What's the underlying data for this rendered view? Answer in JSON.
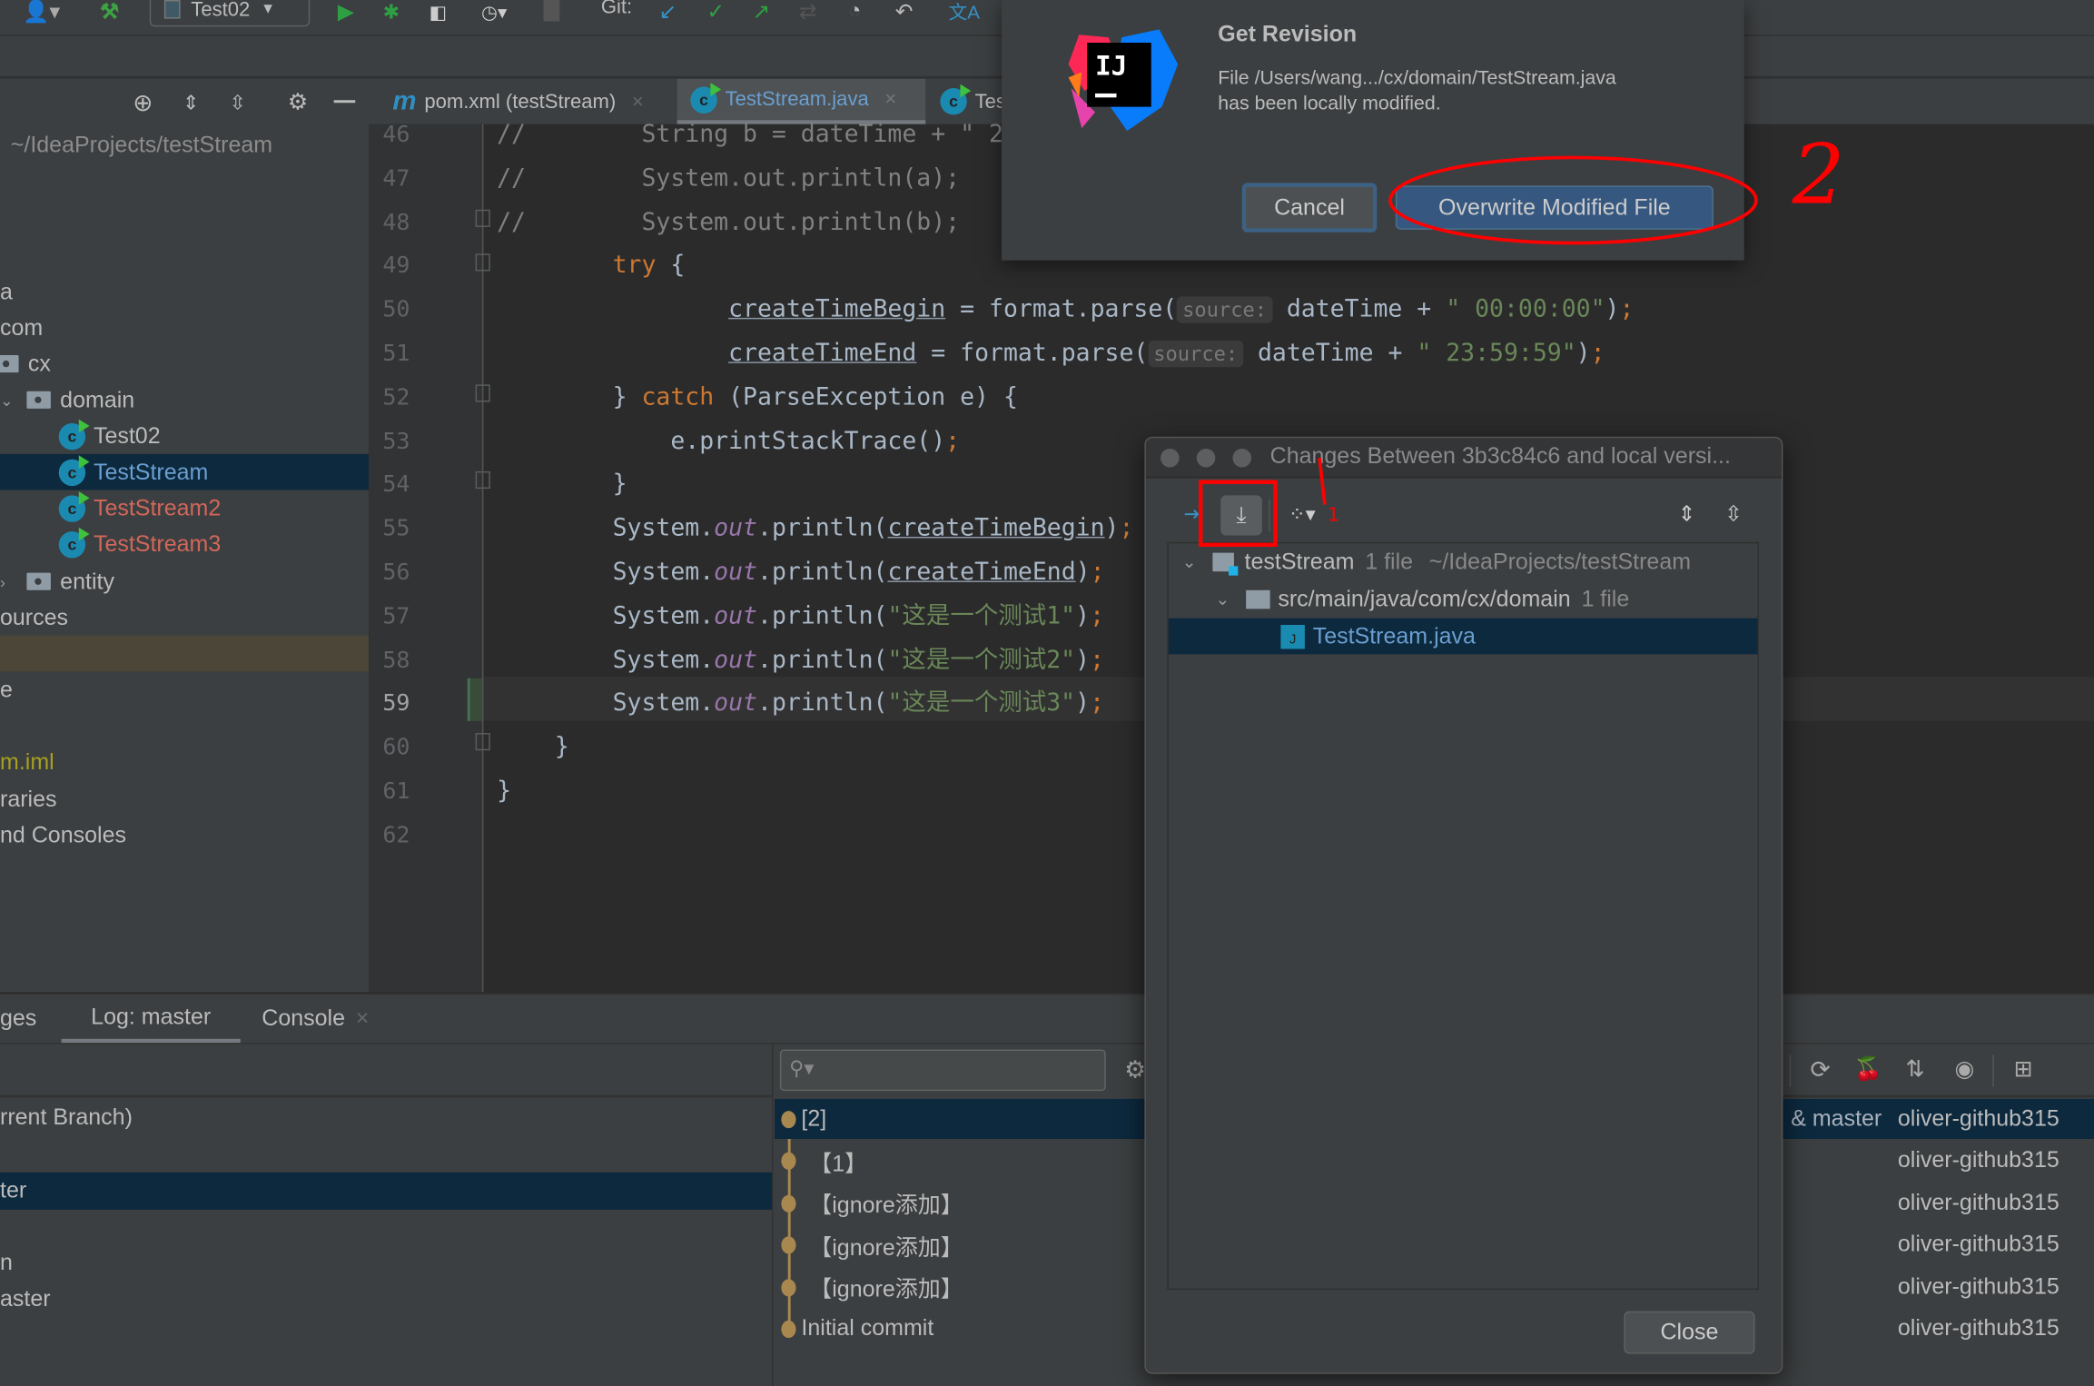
{
  "toolbar": {
    "run_config": "Test02",
    "git_label": "Git:",
    "icons": [
      "user-icon",
      "build-hammer-icon",
      "run-icon",
      "debug-icon",
      "coverage-icon",
      "profile-icon",
      "stop-icon",
      "git-update-icon",
      "git-commit-icon",
      "git-push-icon",
      "git-compare-icon",
      "history-icon",
      "rollback-icon",
      "translate-icon"
    ]
  },
  "project": {
    "path": "~/IdeaProjects/testStream",
    "items": [
      {
        "label": "a"
      },
      {
        "label": "com"
      },
      {
        "label": "cx",
        "icon": "folder-icon"
      },
      {
        "label": "domain",
        "icon": "folder-icon",
        "expanded": true
      },
      {
        "label": "Test02",
        "icon": "class-icon"
      },
      {
        "label": "TestStream",
        "icon": "class-icon",
        "selected": true
      },
      {
        "label": "TestStream2",
        "icon": "class-icon",
        "status": "unversioned"
      },
      {
        "label": "TestStream3",
        "icon": "class-icon",
        "status": "unversioned"
      },
      {
        "label": "entity",
        "icon": "folder-icon",
        "expanded": false
      },
      {
        "label": "ources"
      },
      {
        "label": ""
      },
      {
        "label": "e"
      },
      {
        "label": ""
      },
      {
        "label": "m.iml",
        "status": "ignored"
      },
      {
        "label": "raries"
      },
      {
        "label": "nd Consoles"
      }
    ]
  },
  "editor_tabs": [
    {
      "label": "pom.xml (testStream)",
      "icon": "maven-icon"
    },
    {
      "label": "TestStream.java",
      "icon": "class-icon",
      "active": true
    },
    {
      "label": "Tes",
      "icon": "class-icon"
    }
  ],
  "editor": {
    "current_line": 59,
    "lines": [
      {
        "n": "46",
        "segs": [
          {
            "t": "//        String b = dateTime + \" 2",
            "c": "c"
          }
        ]
      },
      {
        "n": "47",
        "segs": [
          {
            "t": "//        System.out.println(a);",
            "c": "c"
          }
        ]
      },
      {
        "n": "48",
        "segs": [
          {
            "t": "//        System.out.println(b);",
            "c": "c"
          }
        ]
      },
      {
        "n": "49",
        "segs": [
          {
            "t": "        "
          },
          {
            "t": "try",
            "c": "k"
          },
          {
            "t": " {"
          }
        ]
      },
      {
        "n": "50",
        "segs": [
          {
            "t": "                "
          },
          {
            "t": "createTimeBegin",
            "c": "u"
          },
          {
            "t": " = format.parse("
          },
          {
            "t": "source:",
            "c": "h"
          },
          {
            "t": " dateTime + "
          },
          {
            "t": "\" 00:00:00\"",
            "c": "s"
          },
          {
            "t": ")"
          },
          {
            "t": ";",
            "c": "sc"
          }
        ]
      },
      {
        "n": "51",
        "segs": [
          {
            "t": "                "
          },
          {
            "t": "createTimeEnd",
            "c": "u"
          },
          {
            "t": " = format.parse("
          },
          {
            "t": "source:",
            "c": "h"
          },
          {
            "t": " dateTime + "
          },
          {
            "t": "\" 23:59:59\"",
            "c": "s"
          },
          {
            "t": ")"
          },
          {
            "t": ";",
            "c": "sc"
          }
        ]
      },
      {
        "n": "52",
        "segs": [
          {
            "t": "        } "
          },
          {
            "t": "catch",
            "c": "k"
          },
          {
            "t": " (ParseException e) {"
          }
        ]
      },
      {
        "n": "53",
        "segs": [
          {
            "t": "            e.printStackTrace()"
          },
          {
            "t": ";",
            "c": "sc"
          }
        ]
      },
      {
        "n": "54",
        "segs": [
          {
            "t": "        }"
          }
        ]
      },
      {
        "n": "55",
        "segs": [
          {
            "t": "        System."
          },
          {
            "t": "out",
            "c": "f"
          },
          {
            "t": ".println("
          },
          {
            "t": "createTimeBegin",
            "c": "u"
          },
          {
            "t": ")"
          },
          {
            "t": ";",
            "c": "sc"
          }
        ]
      },
      {
        "n": "56",
        "segs": [
          {
            "t": "        System."
          },
          {
            "t": "out",
            "c": "f"
          },
          {
            "t": ".println("
          },
          {
            "t": "createTimeEnd",
            "c": "u"
          },
          {
            "t": ")"
          },
          {
            "t": ";",
            "c": "sc"
          }
        ]
      },
      {
        "n": "57",
        "segs": [
          {
            "t": "        System."
          },
          {
            "t": "out",
            "c": "f"
          },
          {
            "t": ".println("
          },
          {
            "t": "\"这是一个测试1\"",
            "c": "s"
          },
          {
            "t": ")"
          },
          {
            "t": ";",
            "c": "sc"
          }
        ]
      },
      {
        "n": "58",
        "segs": [
          {
            "t": "        System."
          },
          {
            "t": "out",
            "c": "f"
          },
          {
            "t": ".println("
          },
          {
            "t": "\"这是一个测试2\"",
            "c": "s"
          },
          {
            "t": ")"
          },
          {
            "t": ";",
            "c": "sc"
          }
        ]
      },
      {
        "n": "59",
        "segs": [
          {
            "t": "        System."
          },
          {
            "t": "out",
            "c": "f"
          },
          {
            "t": ".println("
          },
          {
            "t": "\"这是一个测试3\"",
            "c": "s"
          },
          {
            "t": ")"
          },
          {
            "t": ";",
            "c": "sc"
          }
        ]
      },
      {
        "n": "60",
        "segs": [
          {
            "t": "    }"
          }
        ]
      },
      {
        "n": "61",
        "segs": [
          {
            "t": "}"
          }
        ]
      },
      {
        "n": "62",
        "segs": []
      }
    ]
  },
  "bottom": {
    "tabs": [
      {
        "label": "ges"
      },
      {
        "label": "Log: master",
        "active": true
      },
      {
        "label": "Console",
        "closable": true
      }
    ],
    "branches": [
      {
        "label": "rrent Branch)"
      },
      {
        "label": "ter",
        "selected": true
      },
      {
        "label": "n"
      },
      {
        "label": "aster"
      }
    ],
    "search_placeholder": "",
    "commits": [
      {
        "message": "[2]",
        "refs": "& master",
        "author": "oliver-github315",
        "selected": true
      },
      {
        "message": "【1】",
        "refs": "",
        "author": "oliver-github315"
      },
      {
        "message": "【ignore添加】",
        "refs": "",
        "author": "oliver-github315"
      },
      {
        "message": "【ignore添加】",
        "refs": "",
        "author": "oliver-github315"
      },
      {
        "message": "【ignore添加】",
        "refs": "",
        "author": "oliver-github315"
      },
      {
        "message": "Initial commit",
        "refs": "",
        "author": "oliver-github315"
      }
    ],
    "graph_color": "#a8884e"
  },
  "get_revision_dialog": {
    "title": "Get Revision",
    "message_line1": "File /Users/wang.../cx/domain/TestStream.java",
    "message_line2": "has been locally modified.",
    "cancel": "Cancel",
    "overwrite": "Overwrite Modified File",
    "logo_text": "IJ"
  },
  "changes_dialog": {
    "title": "Changes Between 3b3c84c6 and local versi...",
    "tree": [
      {
        "label": "testStream",
        "count": "1 file",
        "path": "~/IdeaProjects/testStream"
      },
      {
        "label": "src/main/java/com/cx/domain",
        "count": "1 file"
      },
      {
        "label": "TestStream.java",
        "selected": true
      }
    ],
    "close": "Close"
  },
  "annotations": {
    "step1": "1",
    "step2": "2",
    "color": "#ff0000"
  }
}
